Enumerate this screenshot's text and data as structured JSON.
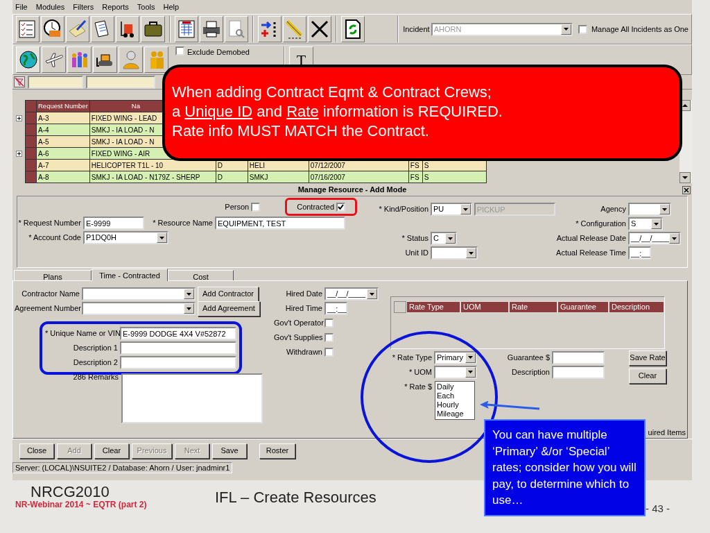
{
  "menu": [
    "File",
    "Modules",
    "Filters",
    "Reports",
    "Tools",
    "Help"
  ],
  "incident": {
    "label": "Incident",
    "value": "AHORN"
  },
  "manage_all": {
    "label": "Manage All Incidents as One",
    "checked": false
  },
  "exclude_demobed": {
    "label": "Exclude Demobed",
    "checked": false
  },
  "text_button": "T",
  "grid": {
    "columns": [
      "Request Number",
      "Na"
    ],
    "rows": [
      {
        "expandable": true,
        "cells": [
          "A-3",
          "FIXED WING - LEAD"
        ]
      },
      {
        "expandable": false,
        "cells": [
          "A-4",
          "SMKJ - IA LOAD - N"
        ]
      },
      {
        "expandable": false,
        "cells": [
          "A-5",
          "SMKJ - IA LOAD - N"
        ]
      },
      {
        "expandable": true,
        "cells": [
          "A-6",
          "FIXED WING - AIR"
        ]
      },
      {
        "expandable": false,
        "cells": [
          "A-7",
          "HELICOPTER T1L - 10",
          "D",
          "HELI",
          "07/12/2007",
          "FS",
          "S"
        ]
      },
      {
        "expandable": false,
        "cells": [
          "A-8",
          "SMKJ - IA LOAD - N179Z - SHERP",
          "D",
          "SMKJ",
          "07/16/2007",
          "FS",
          "S"
        ]
      }
    ]
  },
  "dialog": {
    "title": "Manage Resource - Add Mode",
    "person": {
      "label": "Person",
      "checked": false
    },
    "contracted": {
      "label": "Contracted",
      "checked": true
    },
    "request_number": {
      "label": "* Request Number",
      "value": "E-9999"
    },
    "resource_name": {
      "label": "* Resource Name",
      "value": "EQUIPMENT, TEST"
    },
    "account_code": {
      "label": "* Account Code",
      "value": "P1DQ0H"
    },
    "kind_position": {
      "label": "* Kind/Position",
      "value": "PU",
      "description": "PICKUP"
    },
    "status": {
      "label": "* Status",
      "value": "C"
    },
    "unit_id": {
      "label": "Unit ID"
    },
    "agency": {
      "label": "Agency"
    },
    "configuration": {
      "label": "* Configuration",
      "value": "S"
    },
    "release_date": {
      "label": "Actual Release Date",
      "value": "__/__/____"
    },
    "release_time": {
      "label": "Actual Release Time",
      "value": "__:__"
    },
    "tabs": [
      {
        "label": "Plans",
        "selected": false
      },
      {
        "label": "Time - Contracted",
        "selected": true
      },
      {
        "label": "Cost",
        "selected": false
      }
    ],
    "contractor_name": {
      "label": "Contractor Name",
      "button": "Add Contractor"
    },
    "agreement_number": {
      "label": "Agreement Number",
      "button": "Add Agreement"
    },
    "unique_name": {
      "label": "* Unique Name or VIN",
      "value": "E-9999 DODGE 4X4  V#52872"
    },
    "description_1": {
      "label": "Description 1"
    },
    "description_2": {
      "label": "Description 2"
    },
    "remarks": {
      "label": "286 Remarks"
    },
    "hired_date": {
      "label": "Hired Date",
      "value": "__/__/____"
    },
    "hired_time": {
      "label": "Hired Time",
      "value": "__:__"
    },
    "flags": [
      {
        "label": "Gov't Operator",
        "checked": false
      },
      {
        "label": "Gov't Supplies",
        "checked": false
      },
      {
        "label": "Withdrawn",
        "checked": false
      }
    ],
    "rate_columns": [
      "Rate Type",
      "UOM",
      "Rate",
      "Guarantee",
      "Description"
    ],
    "rate_type": {
      "label": "* Rate Type",
      "value": "Primary"
    },
    "uom": {
      "label": "* UOM",
      "options": [
        "Daily",
        "Each",
        "Hourly",
        "Mileage"
      ]
    },
    "rate": {
      "label": "* Rate $"
    },
    "guarantee": {
      "label": "Guarantee $"
    },
    "rate_description": {
      "label": "Description"
    },
    "rate_buttons": [
      "Save Rate",
      "Clear"
    ],
    "required_note": "uired Items",
    "buttons": [
      {
        "label": "Close",
        "disabled": false
      },
      {
        "label": "Add",
        "disabled": true
      },
      {
        "label": "Clear",
        "disabled": false
      },
      {
        "label": "Previous",
        "disabled": true
      },
      {
        "label": "Next",
        "disabled": true
      },
      {
        "label": "Save",
        "disabled": false
      },
      {
        "label": "Roster",
        "disabled": false
      }
    ]
  },
  "status_bar": "Server: (LOCAL)\\NSUITE2  /  Database: Ahorn  /  User: jnadminr1",
  "red_callout": [
    [
      {
        "text": "When adding Contract Eqmt & Contract Crews;",
        "underline": false
      }
    ],
    [
      {
        "text": "a ",
        "underline": false
      },
      {
        "text": "Unique ID",
        "underline": true
      },
      {
        "text": " and ",
        "underline": false
      },
      {
        "text": "Rate",
        "underline": true
      },
      {
        "text": " information is REQUIRED.",
        "underline": false
      }
    ],
    [
      {
        "text": "Rate info MUST MATCH the Contract.",
        "underline": false
      }
    ]
  ],
  "blue_callout": "You can have multiple ‘Primary’ &/or ‘Special’ rates; consider how you will pay, to determine which to use…",
  "slide": {
    "conference": "NRCG2010",
    "webinar": "NR-Webinar 2014 ~ EQTR (part 2)",
    "title": "IFL – Create Resources",
    "page": "- 43 -"
  }
}
